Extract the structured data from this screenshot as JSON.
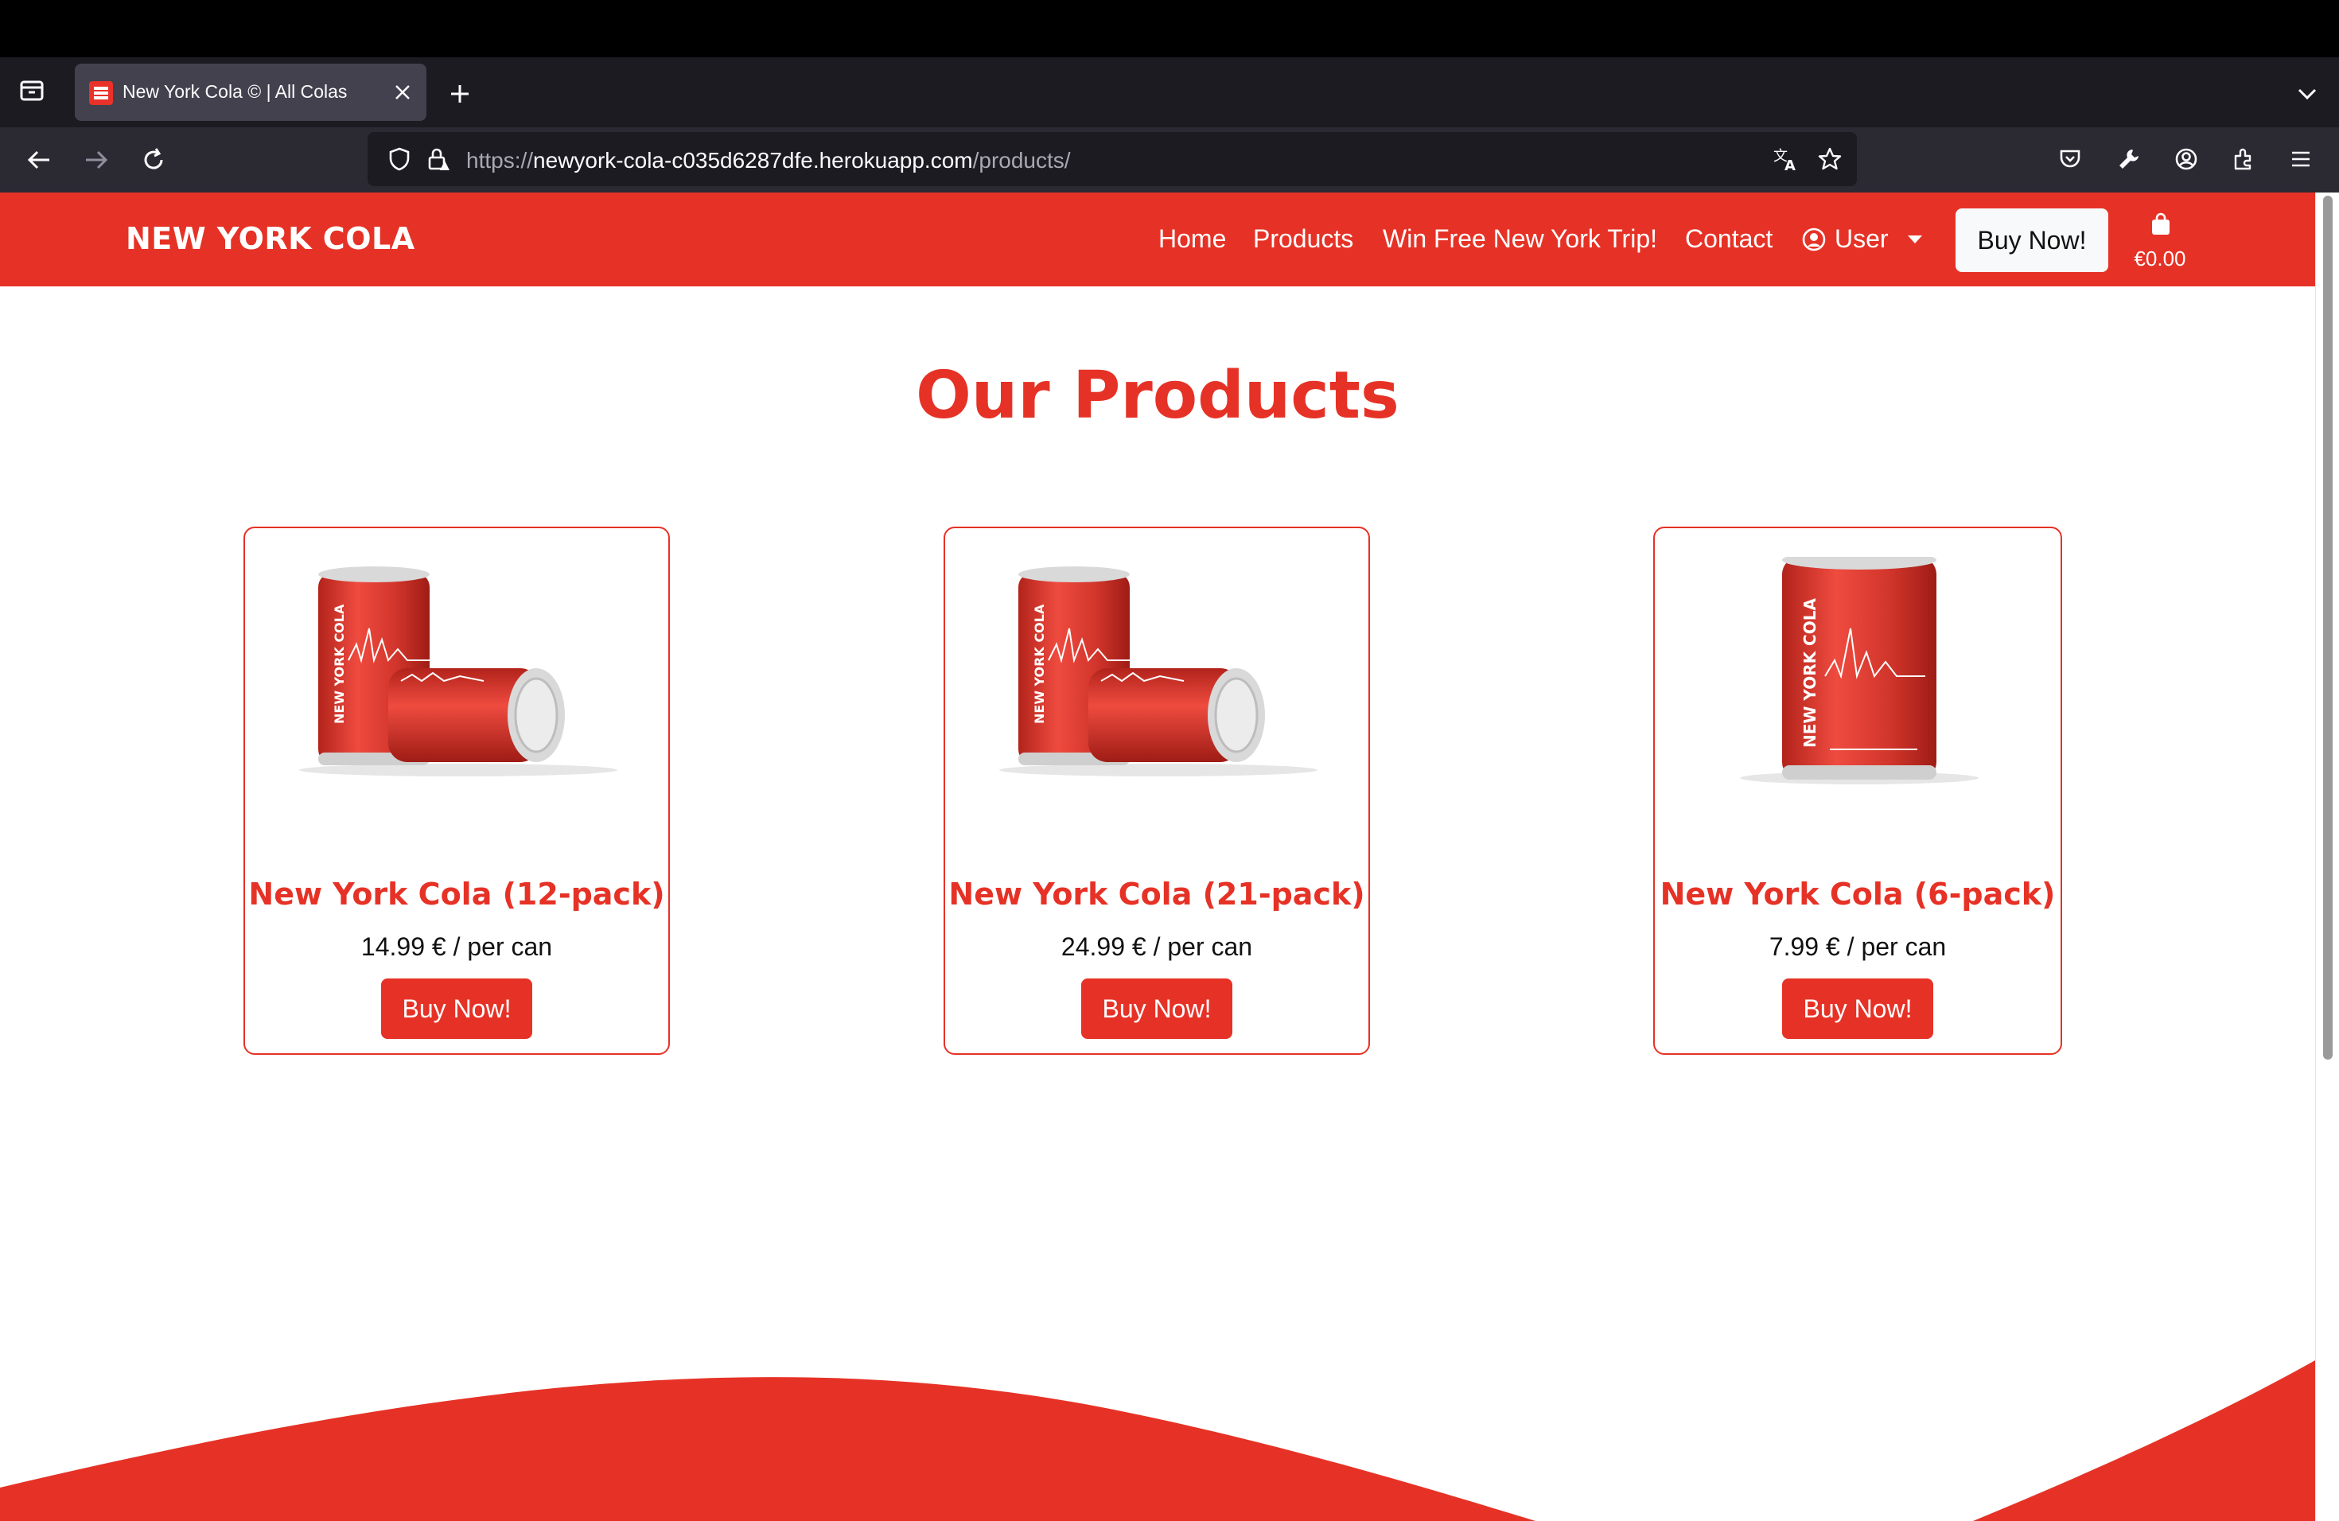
{
  "browser": {
    "tab_title": "New York Cola © | All Colas",
    "url_protocol": "https://",
    "url_host": "newyork-cola-c035d6287dfe.herokuapp.com",
    "url_path": "/products/"
  },
  "navbar": {
    "brand": "NEW YORK COLA",
    "links": [
      "Home",
      "Products",
      "Win Free New York Trip!",
      "Contact"
    ],
    "user_label": "User",
    "buy_label": "Buy Now!",
    "cart_amount": "€0.00"
  },
  "main": {
    "title": "Our Products",
    "products": [
      {
        "name": "New York Cola (12-pack)",
        "price": "14.99 € / per can",
        "button": "Buy Now!",
        "image": "two-cans"
      },
      {
        "name": "New York Cola (21-pack)",
        "price": "24.99 € / per can",
        "button": "Buy Now!",
        "image": "two-cans"
      },
      {
        "name": "New York Cola (6-pack)",
        "price": "7.99 € / per can",
        "button": "Buy Now!",
        "image": "single-can"
      }
    ]
  },
  "colors": {
    "brand_red": "#e63226",
    "chrome_dark": "#1c1b22",
    "chrome_toolbar": "#2b2a33"
  },
  "icons": [
    "tab-overview-icon",
    "close-icon",
    "plus-icon",
    "chevron-down-icon",
    "back-icon",
    "forward-icon",
    "reload-icon",
    "shield-icon",
    "lock-icon",
    "translate-icon",
    "star-icon",
    "pocket-icon",
    "wrench-icon",
    "account-icon",
    "extensions-icon",
    "menu-icon",
    "user-circle-icon",
    "shopping-bag-icon"
  ]
}
